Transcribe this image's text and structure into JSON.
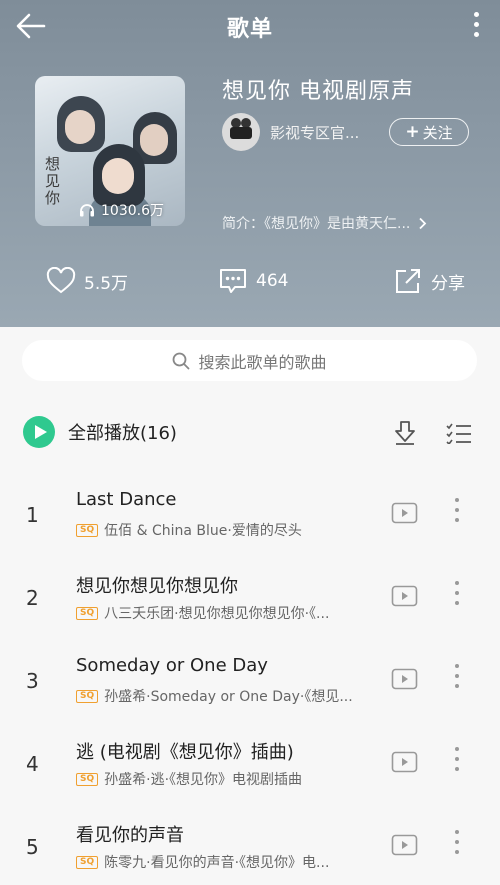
{
  "topbar": {
    "title": "歌单"
  },
  "playlist": {
    "cover_art_text": "想见你",
    "play_count": "1030.6万",
    "title": "想见你 电视剧原声",
    "creator_name": "影视专区官...",
    "follow_label": "关注",
    "intro": "简介：《想见你》是由黄天仁..."
  },
  "actions": {
    "like_count": "5.5万",
    "comment_count": "464",
    "share_label": "分享"
  },
  "search": {
    "placeholder": "搜索此歌单的歌曲"
  },
  "playall": {
    "label": "全部播放(16)"
  },
  "badge_label": "SQ",
  "songs": [
    {
      "index": "1",
      "title": "Last Dance",
      "meta": "伍佰 & China Blue·爱情的尽头"
    },
    {
      "index": "2",
      "title": "想见你想见你想见你",
      "meta": "八三夭乐团·想见你想见你想见你·《..."
    },
    {
      "index": "3",
      "title": "Someday or One Day",
      "meta": "孙盛希·Someday or One Day·《想见..."
    },
    {
      "index": "4",
      "title": "逃 (电视剧《想见你》插曲)",
      "meta": "孙盛希·逃·《想见你》电视剧插曲"
    },
    {
      "index": "5",
      "title": "看见你的声音",
      "meta": "陈零九·看见你的声音·《想见你》电..."
    }
  ],
  "colors": {
    "accent": "#2fc98f",
    "sq_badge": "#f0a030",
    "header_bg": "#8896a2"
  }
}
